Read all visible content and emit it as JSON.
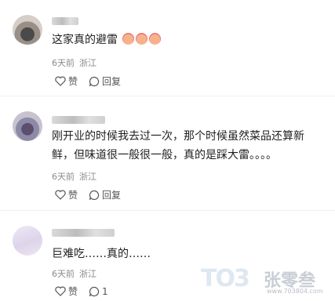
{
  "comments": [
    {
      "text": "这家真的避雷",
      "emoji_count": 3,
      "time": "6天前",
      "location": "浙江",
      "like_label": "赞",
      "reply_label": "回复"
    },
    {
      "text_line1": "刚开业的时候我去过一次，那个时候虽然菜品还算新",
      "text_line2": "鲜，但味道很一般很一般，真的是踩大雷。。。。",
      "time": "6天前",
      "location": "浙江",
      "like_label": "赞",
      "reply_label": "回复"
    },
    {
      "text": "巨难吃……真的……",
      "time": "6天前",
      "location": "浙江",
      "like_label": "赞",
      "reply_count": "1"
    }
  ],
  "watermark": {
    "logo": "TO3",
    "name": "张零叁",
    "url": "www.703804.com"
  },
  "colors": {
    "text": "#1f1f1f",
    "meta": "#8a8a8a",
    "divider": "#f0f0f0"
  }
}
